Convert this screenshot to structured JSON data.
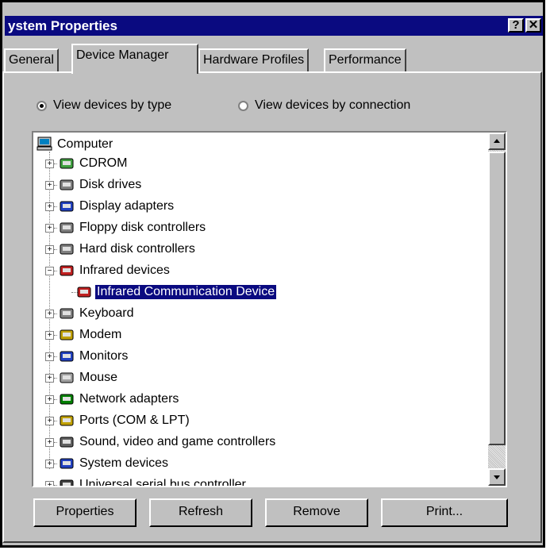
{
  "window": {
    "title": "ystem Properties",
    "help_label": "?",
    "close_label": "✕"
  },
  "tabs": [
    {
      "label": "General",
      "active": false
    },
    {
      "label": "Device Manager",
      "active": true
    },
    {
      "label": "Hardware Profiles",
      "active": false
    },
    {
      "label": "Performance",
      "active": false
    }
  ],
  "view": {
    "by_type": "View devices by type",
    "by_connection": "View devices by connection",
    "selected": "by_type"
  },
  "tree": {
    "root": "Computer",
    "items": [
      {
        "label": "CDROM",
        "icon": "cdrom-icon",
        "expander": "+"
      },
      {
        "label": "Disk drives",
        "icon": "disk-drive-icon",
        "expander": "+"
      },
      {
        "label": "Display adapters",
        "icon": "display-adapter-icon",
        "expander": "+"
      },
      {
        "label": "Floppy disk controllers",
        "icon": "floppy-controller-icon",
        "expander": "+"
      },
      {
        "label": "Hard disk controllers",
        "icon": "hard-disk-controller-icon",
        "expander": "+"
      },
      {
        "label": "Infrared devices",
        "icon": "infrared-icon",
        "expander": "−"
      },
      {
        "label": "Infrared Communication Device",
        "icon": "infrared-icon",
        "expander": "",
        "child": true,
        "selected": true
      },
      {
        "label": "Keyboard",
        "icon": "keyboard-icon",
        "expander": "+"
      },
      {
        "label": "Modem",
        "icon": "modem-icon",
        "expander": "+"
      },
      {
        "label": "Monitors",
        "icon": "monitor-icon",
        "expander": "+"
      },
      {
        "label": "Mouse",
        "icon": "mouse-icon",
        "expander": "+"
      },
      {
        "label": "Network adapters",
        "icon": "network-adapter-icon",
        "expander": "+"
      },
      {
        "label": "Ports (COM & LPT)",
        "icon": "port-icon",
        "expander": "+"
      },
      {
        "label": "Sound, video and game controllers",
        "icon": "sound-icon",
        "expander": "+"
      },
      {
        "label": "System devices",
        "icon": "system-device-icon",
        "expander": "+"
      },
      {
        "label": "Universal serial bus controller",
        "icon": "usb-icon",
        "expander": "+"
      }
    ]
  },
  "buttons": {
    "properties": "Properties",
    "refresh": "Refresh",
    "remove": "Remove",
    "print": "Print..."
  }
}
